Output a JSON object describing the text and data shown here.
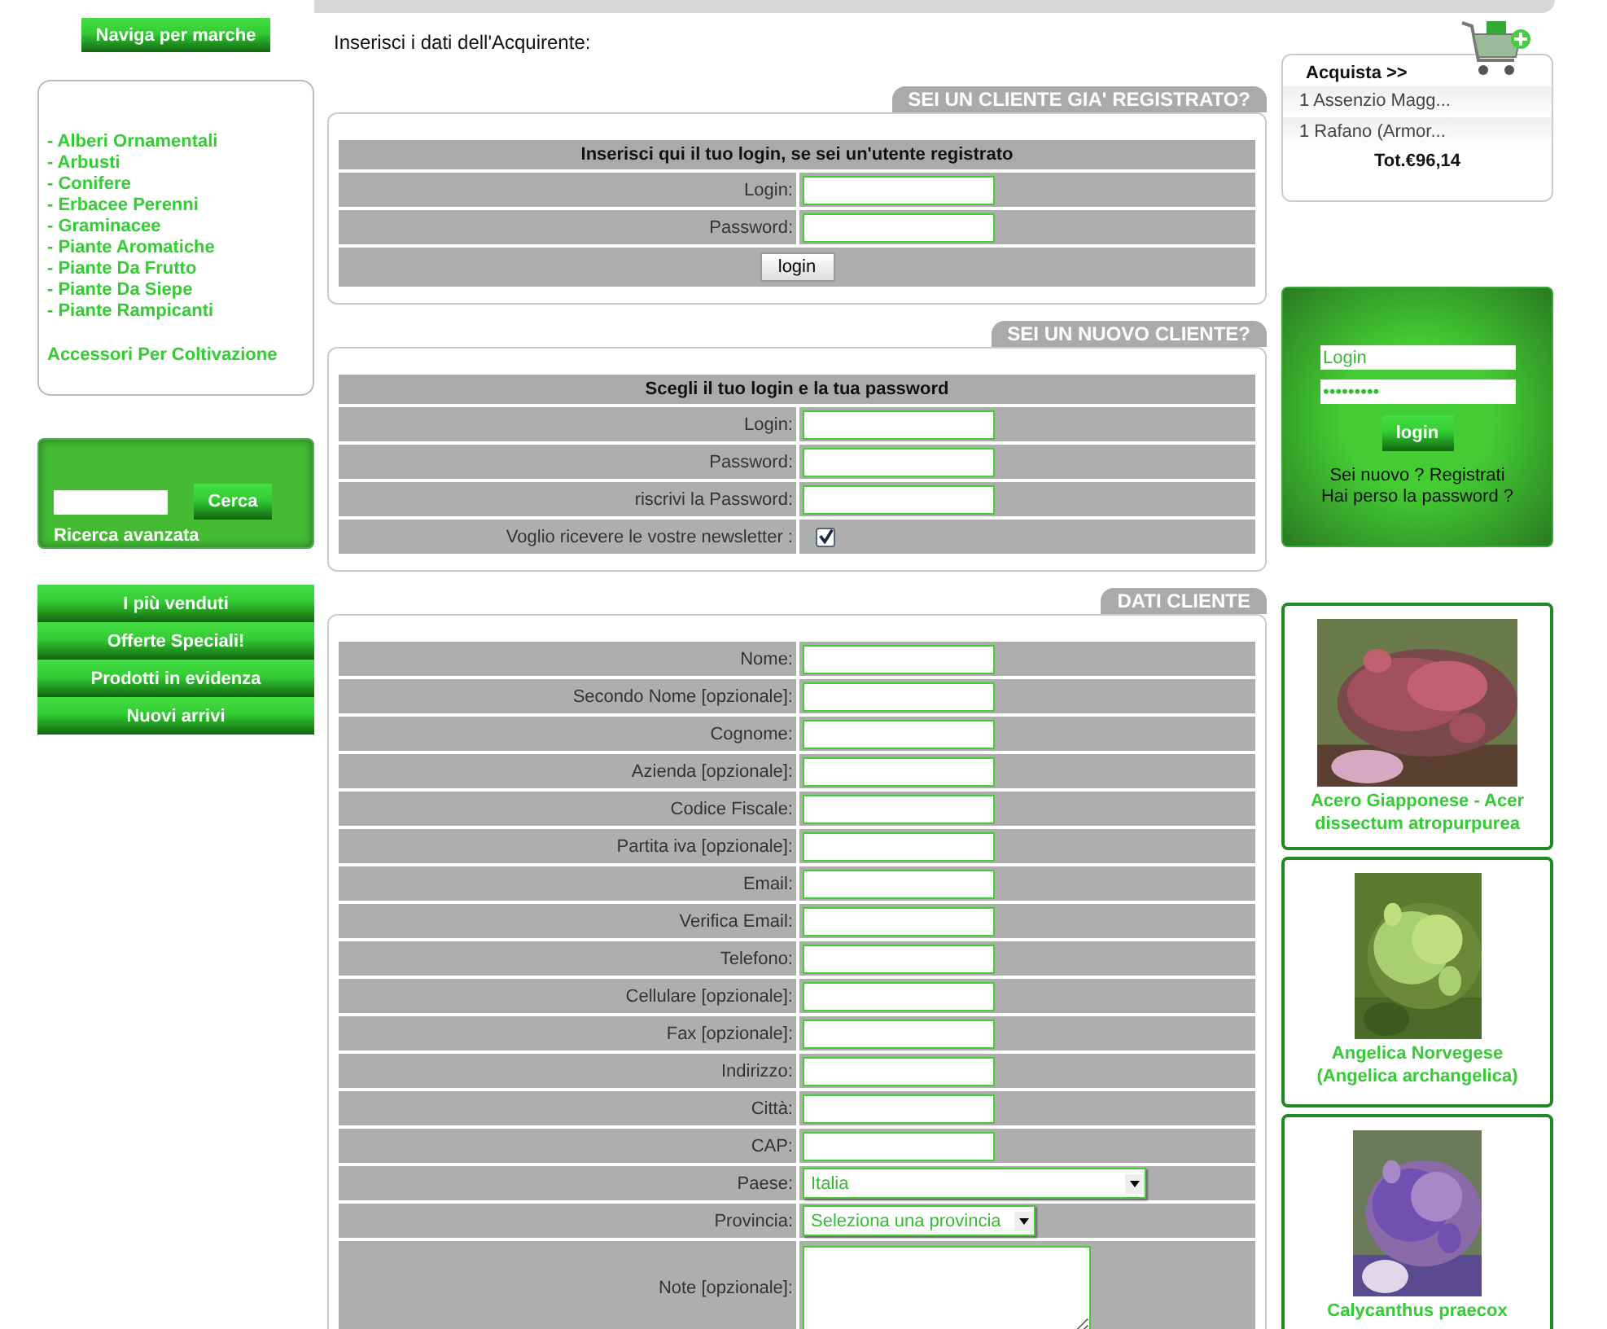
{
  "nav_brands_button": "Naviga per marche",
  "categories": [
    "- Alberi Ornamentali",
    "- Arbusti",
    "- Conifere",
    "- Erbacee Perenni",
    "- Graminacee",
    "- Piante Aromatiche",
    "- Piante Da Frutto",
    "- Piante Da Siepe",
    "- Piante Rampicanti"
  ],
  "accessories": "Accessori Per Coltivazione",
  "search": {
    "button": "Cerca",
    "advanced": "Ricerca avanzata"
  },
  "menu": [
    "I più venduti",
    "Offerte Speciali!",
    "Prodotti in evidenza",
    "Nuovi arrivi"
  ],
  "intro": "Inserisci i dati dell'Acquirente:",
  "sections": [
    {
      "tab": "SEI UN CLIENTE GIA' REGISTRATO?",
      "heading": "Inserisci qui il tuo login, se sei un'utente registrato",
      "fields": [
        {
          "kind": "text",
          "label": "Login:"
        },
        {
          "kind": "text",
          "label": "Password:"
        }
      ],
      "button": "login"
    },
    {
      "tab": "SEI UN NUOVO CLIENTE?",
      "heading": "Scegli il tuo login e la tua password",
      "fields": [
        {
          "kind": "text",
          "label": "Login:"
        },
        {
          "kind": "text",
          "label": "Password:"
        },
        {
          "kind": "text",
          "label": "riscrivi la Password:"
        },
        {
          "kind": "checkbox",
          "label": "Voglio ricevere le vostre newsletter :",
          "checked": true
        }
      ]
    },
    {
      "tab": "DATI CLIENTE",
      "fields": [
        {
          "kind": "text",
          "label": "Nome:"
        },
        {
          "kind": "text",
          "label": "Secondo Nome [opzionale]:"
        },
        {
          "kind": "text",
          "label": "Cognome:"
        },
        {
          "kind": "text",
          "label": "Azienda [opzionale]:"
        },
        {
          "kind": "text",
          "label": "Codice Fiscale:"
        },
        {
          "kind": "text",
          "label": "Partita iva [opzionale]:"
        },
        {
          "kind": "text",
          "label": "Email:"
        },
        {
          "kind": "text",
          "label": "Verifica Email:"
        },
        {
          "kind": "text",
          "label": "Telefono:"
        },
        {
          "kind": "text",
          "label": "Cellulare [opzionale]:"
        },
        {
          "kind": "text",
          "label": "Fax [opzionale]:"
        },
        {
          "kind": "text",
          "label": "Indirizzo:"
        },
        {
          "kind": "text",
          "label": "Città:"
        },
        {
          "kind": "text",
          "label": "CAP:"
        },
        {
          "kind": "select",
          "label": "Paese:",
          "value": "Italia",
          "wide": true
        },
        {
          "kind": "select",
          "label": "Provincia:",
          "value": "Seleziona una provincia",
          "wide": false
        },
        {
          "kind": "textarea",
          "label": "Note [opzionale]:"
        }
      ]
    }
  ],
  "cart": {
    "title": "Acquista >>",
    "items": [
      "1 Assenzio Magg...",
      "1 Rafano (Armor..."
    ],
    "total": "Tot.€96,14"
  },
  "login_box": {
    "login_value": "Login",
    "password_value": "•••••••••",
    "button": "login",
    "register": "Sei nuovo ? Registrati",
    "lost": "Hai perso la password ?"
  },
  "products": [
    {
      "name": "Acero Giapponese - Acer dissectum atropurpurea",
      "kind": "picture"
    },
    {
      "name": "Angelica Norvegese (Angelica archangelica)",
      "kind": "picture"
    },
    {
      "name": "Calycanthus praecox",
      "kind": "picture"
    }
  ]
}
